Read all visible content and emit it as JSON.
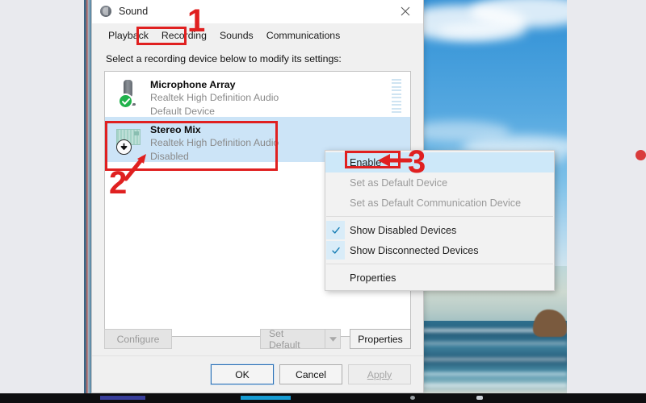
{
  "window": {
    "title": "Sound",
    "icon": "speaker-icon",
    "close_label": "close-icon"
  },
  "tabs": [
    {
      "label": "Playback",
      "active": false
    },
    {
      "label": "Recording",
      "active": true
    },
    {
      "label": "Sounds",
      "active": false
    },
    {
      "label": "Communications",
      "active": false
    }
  ],
  "hint": "Select a recording device below to modify its settings:",
  "devices": [
    {
      "name": "Microphone Array",
      "driver": "Realtek High Definition Audio",
      "status": "Default Device",
      "icon": "microphone-icon",
      "badge": "check-badge-icon",
      "selected": false,
      "meter_segments": 10
    },
    {
      "name": "Stereo Mix",
      "driver": "Realtek High Definition Audio",
      "status": "Disabled",
      "icon": "sound-card-icon",
      "badge": "down-arrow-badge-icon",
      "selected": true,
      "meter_segments": 0
    }
  ],
  "device_buttons": {
    "configure": "Configure",
    "configure_enabled": false,
    "set_default": "Set Default",
    "set_default_enabled": false,
    "set_default_arrow": "chevron-down-icon",
    "properties": "Properties",
    "properties_enabled": true
  },
  "footer": {
    "ok": "OK",
    "cancel": "Cancel",
    "apply": "Apply",
    "apply_enabled": false
  },
  "context_menu": {
    "items": [
      {
        "label": "Enable",
        "state": "highlight",
        "checked": false
      },
      {
        "label": "Set as Default Device",
        "state": "disabled",
        "checked": false
      },
      {
        "label": "Set as Default Communication Device",
        "state": "disabled",
        "checked": false
      },
      {
        "label": "Show Disabled Devices",
        "state": "normal",
        "checked": true
      },
      {
        "label": "Show Disconnected Devices",
        "state": "normal",
        "checked": true
      },
      {
        "label": "Properties",
        "state": "normal",
        "checked": false
      }
    ]
  },
  "annotations": {
    "step1": "1",
    "step2": "2",
    "step3": "3",
    "color": "#e02020"
  }
}
